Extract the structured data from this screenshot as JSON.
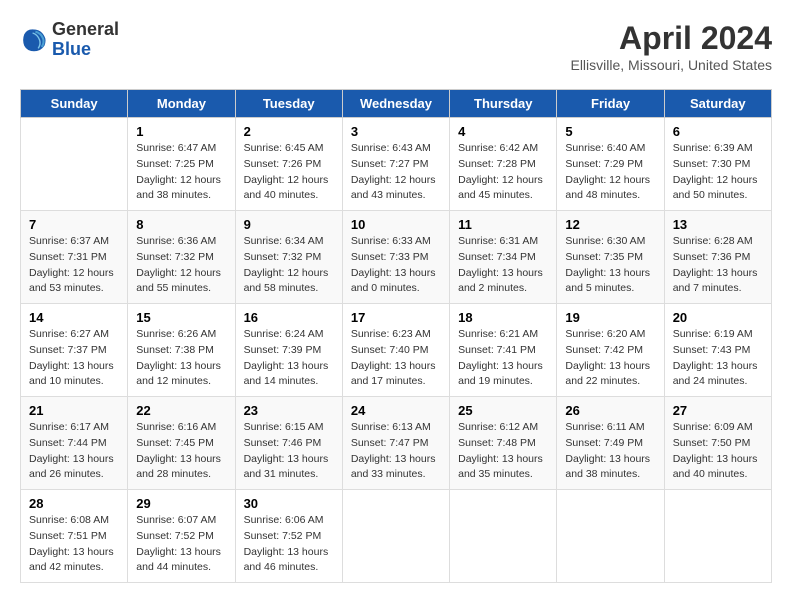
{
  "header": {
    "logo_line1": "General",
    "logo_line2": "Blue",
    "month": "April 2024",
    "location": "Ellisville, Missouri, United States"
  },
  "days_of_week": [
    "Sunday",
    "Monday",
    "Tuesday",
    "Wednesday",
    "Thursday",
    "Friday",
    "Saturday"
  ],
  "weeks": [
    [
      {
        "day": "",
        "sunrise": "",
        "sunset": "",
        "daylight": ""
      },
      {
        "day": "1",
        "sunrise": "Sunrise: 6:47 AM",
        "sunset": "Sunset: 7:25 PM",
        "daylight": "Daylight: 12 hours and 38 minutes."
      },
      {
        "day": "2",
        "sunrise": "Sunrise: 6:45 AM",
        "sunset": "Sunset: 7:26 PM",
        "daylight": "Daylight: 12 hours and 40 minutes."
      },
      {
        "day": "3",
        "sunrise": "Sunrise: 6:43 AM",
        "sunset": "Sunset: 7:27 PM",
        "daylight": "Daylight: 12 hours and 43 minutes."
      },
      {
        "day": "4",
        "sunrise": "Sunrise: 6:42 AM",
        "sunset": "Sunset: 7:28 PM",
        "daylight": "Daylight: 12 hours and 45 minutes."
      },
      {
        "day": "5",
        "sunrise": "Sunrise: 6:40 AM",
        "sunset": "Sunset: 7:29 PM",
        "daylight": "Daylight: 12 hours and 48 minutes."
      },
      {
        "day": "6",
        "sunrise": "Sunrise: 6:39 AM",
        "sunset": "Sunset: 7:30 PM",
        "daylight": "Daylight: 12 hours and 50 minutes."
      }
    ],
    [
      {
        "day": "7",
        "sunrise": "Sunrise: 6:37 AM",
        "sunset": "Sunset: 7:31 PM",
        "daylight": "Daylight: 12 hours and 53 minutes."
      },
      {
        "day": "8",
        "sunrise": "Sunrise: 6:36 AM",
        "sunset": "Sunset: 7:32 PM",
        "daylight": "Daylight: 12 hours and 55 minutes."
      },
      {
        "day": "9",
        "sunrise": "Sunrise: 6:34 AM",
        "sunset": "Sunset: 7:32 PM",
        "daylight": "Daylight: 12 hours and 58 minutes."
      },
      {
        "day": "10",
        "sunrise": "Sunrise: 6:33 AM",
        "sunset": "Sunset: 7:33 PM",
        "daylight": "Daylight: 13 hours and 0 minutes."
      },
      {
        "day": "11",
        "sunrise": "Sunrise: 6:31 AM",
        "sunset": "Sunset: 7:34 PM",
        "daylight": "Daylight: 13 hours and 2 minutes."
      },
      {
        "day": "12",
        "sunrise": "Sunrise: 6:30 AM",
        "sunset": "Sunset: 7:35 PM",
        "daylight": "Daylight: 13 hours and 5 minutes."
      },
      {
        "day": "13",
        "sunrise": "Sunrise: 6:28 AM",
        "sunset": "Sunset: 7:36 PM",
        "daylight": "Daylight: 13 hours and 7 minutes."
      }
    ],
    [
      {
        "day": "14",
        "sunrise": "Sunrise: 6:27 AM",
        "sunset": "Sunset: 7:37 PM",
        "daylight": "Daylight: 13 hours and 10 minutes."
      },
      {
        "day": "15",
        "sunrise": "Sunrise: 6:26 AM",
        "sunset": "Sunset: 7:38 PM",
        "daylight": "Daylight: 13 hours and 12 minutes."
      },
      {
        "day": "16",
        "sunrise": "Sunrise: 6:24 AM",
        "sunset": "Sunset: 7:39 PM",
        "daylight": "Daylight: 13 hours and 14 minutes."
      },
      {
        "day": "17",
        "sunrise": "Sunrise: 6:23 AM",
        "sunset": "Sunset: 7:40 PM",
        "daylight": "Daylight: 13 hours and 17 minutes."
      },
      {
        "day": "18",
        "sunrise": "Sunrise: 6:21 AM",
        "sunset": "Sunset: 7:41 PM",
        "daylight": "Daylight: 13 hours and 19 minutes."
      },
      {
        "day": "19",
        "sunrise": "Sunrise: 6:20 AM",
        "sunset": "Sunset: 7:42 PM",
        "daylight": "Daylight: 13 hours and 22 minutes."
      },
      {
        "day": "20",
        "sunrise": "Sunrise: 6:19 AM",
        "sunset": "Sunset: 7:43 PM",
        "daylight": "Daylight: 13 hours and 24 minutes."
      }
    ],
    [
      {
        "day": "21",
        "sunrise": "Sunrise: 6:17 AM",
        "sunset": "Sunset: 7:44 PM",
        "daylight": "Daylight: 13 hours and 26 minutes."
      },
      {
        "day": "22",
        "sunrise": "Sunrise: 6:16 AM",
        "sunset": "Sunset: 7:45 PM",
        "daylight": "Daylight: 13 hours and 28 minutes."
      },
      {
        "day": "23",
        "sunrise": "Sunrise: 6:15 AM",
        "sunset": "Sunset: 7:46 PM",
        "daylight": "Daylight: 13 hours and 31 minutes."
      },
      {
        "day": "24",
        "sunrise": "Sunrise: 6:13 AM",
        "sunset": "Sunset: 7:47 PM",
        "daylight": "Daylight: 13 hours and 33 minutes."
      },
      {
        "day": "25",
        "sunrise": "Sunrise: 6:12 AM",
        "sunset": "Sunset: 7:48 PM",
        "daylight": "Daylight: 13 hours and 35 minutes."
      },
      {
        "day": "26",
        "sunrise": "Sunrise: 6:11 AM",
        "sunset": "Sunset: 7:49 PM",
        "daylight": "Daylight: 13 hours and 38 minutes."
      },
      {
        "day": "27",
        "sunrise": "Sunrise: 6:09 AM",
        "sunset": "Sunset: 7:50 PM",
        "daylight": "Daylight: 13 hours and 40 minutes."
      }
    ],
    [
      {
        "day": "28",
        "sunrise": "Sunrise: 6:08 AM",
        "sunset": "Sunset: 7:51 PM",
        "daylight": "Daylight: 13 hours and 42 minutes."
      },
      {
        "day": "29",
        "sunrise": "Sunrise: 6:07 AM",
        "sunset": "Sunset: 7:52 PM",
        "daylight": "Daylight: 13 hours and 44 minutes."
      },
      {
        "day": "30",
        "sunrise": "Sunrise: 6:06 AM",
        "sunset": "Sunset: 7:52 PM",
        "daylight": "Daylight: 13 hours and 46 minutes."
      },
      {
        "day": "",
        "sunrise": "",
        "sunset": "",
        "daylight": ""
      },
      {
        "day": "",
        "sunrise": "",
        "sunset": "",
        "daylight": ""
      },
      {
        "day": "",
        "sunrise": "",
        "sunset": "",
        "daylight": ""
      },
      {
        "day": "",
        "sunrise": "",
        "sunset": "",
        "daylight": ""
      }
    ]
  ]
}
